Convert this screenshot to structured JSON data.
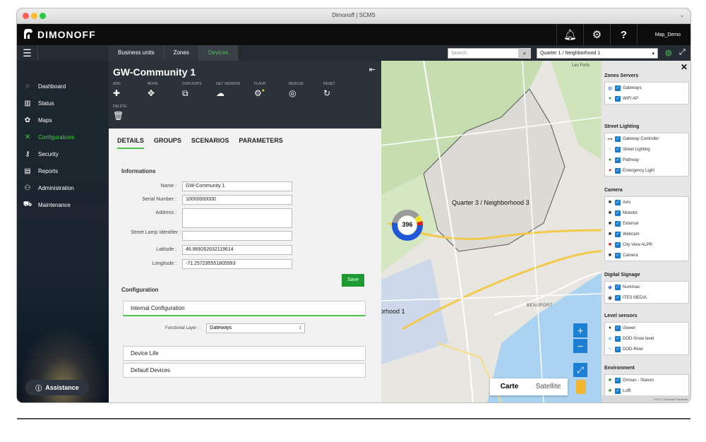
{
  "window": {
    "title": "Dimonoff | SCMS"
  },
  "brand": {
    "logo_text": "DIMONOFF",
    "user": "Map_Demo"
  },
  "nav": {
    "tabs": [
      "Business units",
      "Zones",
      "Devices"
    ],
    "search_placeholder": "Search",
    "zone_selected": "Quarter 1 / Neighborhood 1"
  },
  "sidebar": {
    "items": [
      {
        "label": "Dashboard",
        "icon": "dashboard-icon"
      },
      {
        "label": "Status",
        "icon": "status-icon"
      },
      {
        "label": "Maps",
        "icon": "maps-icon"
      },
      {
        "label": "Configurations",
        "icon": "configurations-icon"
      },
      {
        "label": "Security",
        "icon": "key-icon"
      },
      {
        "label": "Reports",
        "icon": "reports-icon"
      },
      {
        "label": "Administration",
        "icon": "administration-icon"
      },
      {
        "label": "Maintenance",
        "icon": "maintenance-icon"
      }
    ],
    "assistance": "Assistance"
  },
  "panel": {
    "title": "GW-Community 1",
    "actions": [
      "ADD",
      "MOVE",
      "DUPLICATE",
      "GET VERSION",
      "FLASH",
      "RESCUE",
      "RESET",
      "DELETE"
    ],
    "subtabs": [
      "DETAILS",
      "GROUPS",
      "SCENARIOS",
      "PARAMETERS"
    ],
    "informations_title": "Informations",
    "fields": [
      {
        "label": "Name :",
        "value": "GW-Community 1"
      },
      {
        "label": "Serial Number :",
        "value": "10000000000"
      },
      {
        "label": "Address :",
        "value": ""
      },
      {
        "label": "Street Lamp Identifier :",
        "value": ""
      },
      {
        "label": "Latitude :",
        "value": "46.869262632119614"
      },
      {
        "label": "Longitude :",
        "value": "-71.257235551805993"
      }
    ],
    "save": "Save",
    "configuration_title": "Configuration",
    "internal_configuration": "Internal Configuration",
    "functional_layer_label": "Functional Layer :",
    "functional_layer_value": "Gateways",
    "device_life": "Device Life",
    "default_devices": "Default Devices"
  },
  "map": {
    "label_quarter3": "Quarter 3 / Neighborhood 3",
    "label_hood1": "orhood 1",
    "label_beauport": "BEAUPORT",
    "label_lesforts": "Les Forts",
    "cluster_count": "396",
    "maptype": [
      "Carte",
      "Satellite"
    ]
  },
  "layers": {
    "groups": [
      {
        "title": "Zones Servers",
        "items": [
          "Gateways",
          "WIFI AP"
        ]
      },
      {
        "title": "Street Lighting",
        "items": [
          "Gateway Controller",
          "Street Lighting",
          "Pathway",
          "Emergency Light"
        ]
      },
      {
        "title": "Camera",
        "items": [
          "Axis",
          "Mobotix",
          "External",
          "Webcam",
          "City View ALPR",
          "Camera"
        ]
      },
      {
        "title": "Digital Signage",
        "items": [
          "Nummax",
          "ITES MEDIA"
        ]
      },
      {
        "title": "Level sensors",
        "items": [
          "iSewer",
          "DOD-Snow level",
          "DOD-River"
        ]
      },
      {
        "title": "Environment",
        "items": [
          "Omnan - Statum",
          "Lufft"
        ]
      }
    ],
    "copyright": "2021 © Dimonoff Solutions"
  }
}
